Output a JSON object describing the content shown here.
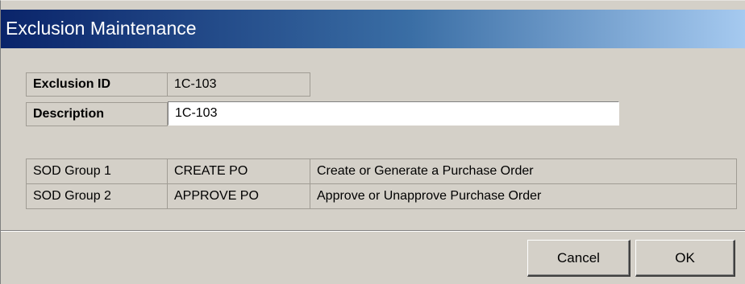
{
  "dialog": {
    "title": "Exclusion Maintenance"
  },
  "form": {
    "exclusion_id_label": "Exclusion ID",
    "exclusion_id_value": "1C-103",
    "description_label": "Description",
    "description_value": "1C-103"
  },
  "sod_groups": [
    {
      "label": "SOD Group 1",
      "code": "CREATE PO",
      "description": "Create or Generate a Purchase Order"
    },
    {
      "label": "SOD Group 2",
      "code": "APPROVE PO",
      "description": "Approve or Unapprove Purchase Order"
    }
  ],
  "buttons": {
    "cancel": "Cancel",
    "ok": "OK"
  }
}
